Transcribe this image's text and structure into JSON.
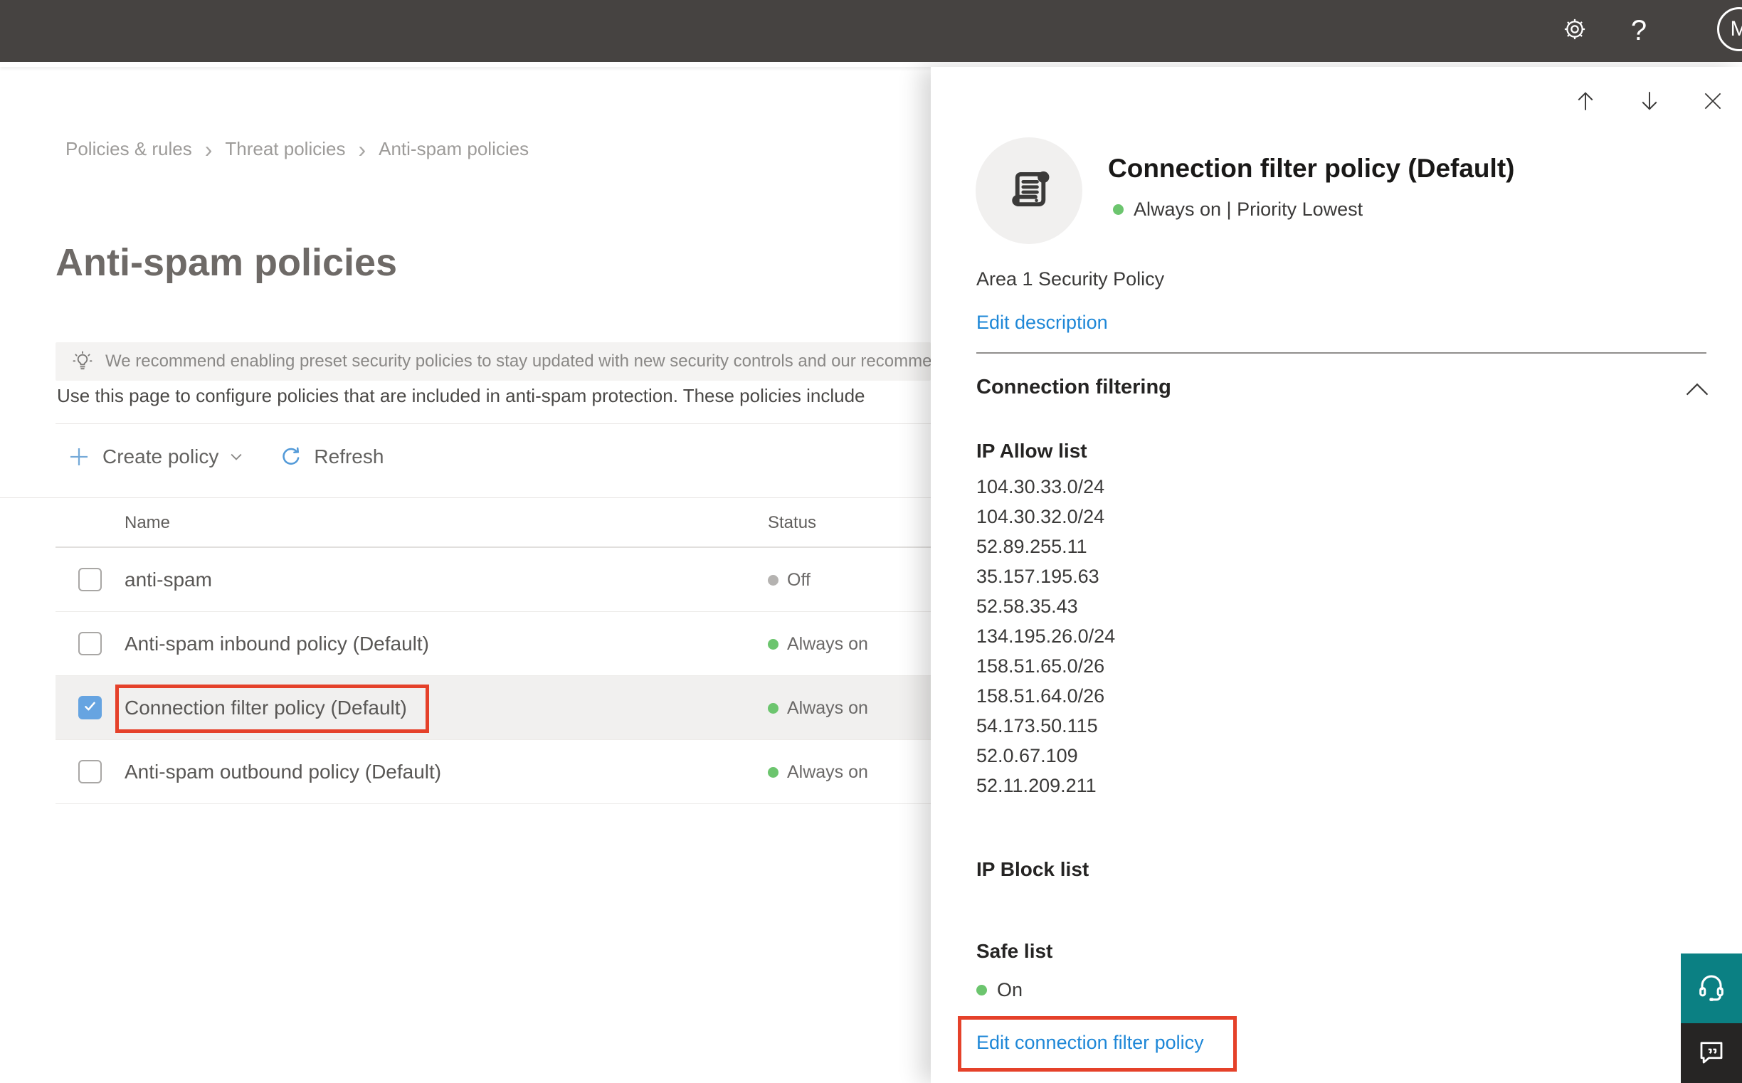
{
  "topbar": {
    "help_label": "?",
    "avatar_initial": "M"
  },
  "breadcrumb": {
    "items": [
      "Policies & rules",
      "Threat policies",
      "Anti-spam policies"
    ],
    "separator": "›"
  },
  "page": {
    "title": "Anti-spam policies",
    "banner_text": "We recommend enabling preset security policies to stay updated with new security controls and our recomme",
    "intro_text": "Use this page to configure policies that are included in anti-spam protection. These policies include"
  },
  "toolbar": {
    "create_policy_label": "Create policy",
    "refresh_label": "Refresh"
  },
  "table": {
    "columns": {
      "name": "Name",
      "status": "Status"
    },
    "rows": [
      {
        "name": "anti-spam",
        "status_label": "Off",
        "status": "off",
        "selected": false
      },
      {
        "name": "Anti-spam inbound policy (Default)",
        "status_label": "Always on",
        "status": "on",
        "selected": false
      },
      {
        "name": "Connection filter policy (Default)",
        "status_label": "Always on",
        "status": "on",
        "selected": true
      },
      {
        "name": "Anti-spam outbound policy (Default)",
        "status_label": "Always on",
        "status": "on",
        "selected": false
      }
    ]
  },
  "panel": {
    "title": "Connection filter policy (Default)",
    "status_line": "Always on | Priority Lowest",
    "description": "Area 1 Security Policy",
    "edit_description_label": "Edit description",
    "section_title": "Connection filtering",
    "ip_allow_title": "IP Allow list",
    "ip_allow_list": [
      "104.30.33.0/24",
      "104.30.32.0/24",
      "52.89.255.11",
      "35.157.195.63",
      "52.58.35.43",
      "134.195.26.0/24",
      "158.51.65.0/26",
      "158.51.64.0/26",
      "54.173.50.115",
      "52.0.67.109",
      "52.11.209.211"
    ],
    "ip_block_title": "IP Block list",
    "safe_list_title": "Safe list",
    "safe_list_status": "On",
    "edit_link_label": "Edit connection filter policy"
  },
  "icons": {
    "gear": "gear-icon",
    "help": "?",
    "up_arrow": "↑",
    "down_arrow": "↓",
    "close": "×",
    "scroll": "scroll-icon",
    "lightbulb": "lightbulb-icon",
    "plus": "+",
    "chevron_down": "⌄",
    "chevron_up": "⌃",
    "refresh": "refresh-icon",
    "checkmark": "✓",
    "headset": "headset-icon",
    "feedback": "feedback-icon"
  },
  "colors": {
    "topbar_dark": "#464341",
    "accent_blue": "#1e87d7",
    "checkbox_blue": "#66a4e1",
    "status_green": "#6cc56e",
    "status_gray": "#b5b3b1",
    "highlight_red": "#e5412a",
    "teal_widget": "#0b8083",
    "dark_widget": "#262524"
  }
}
